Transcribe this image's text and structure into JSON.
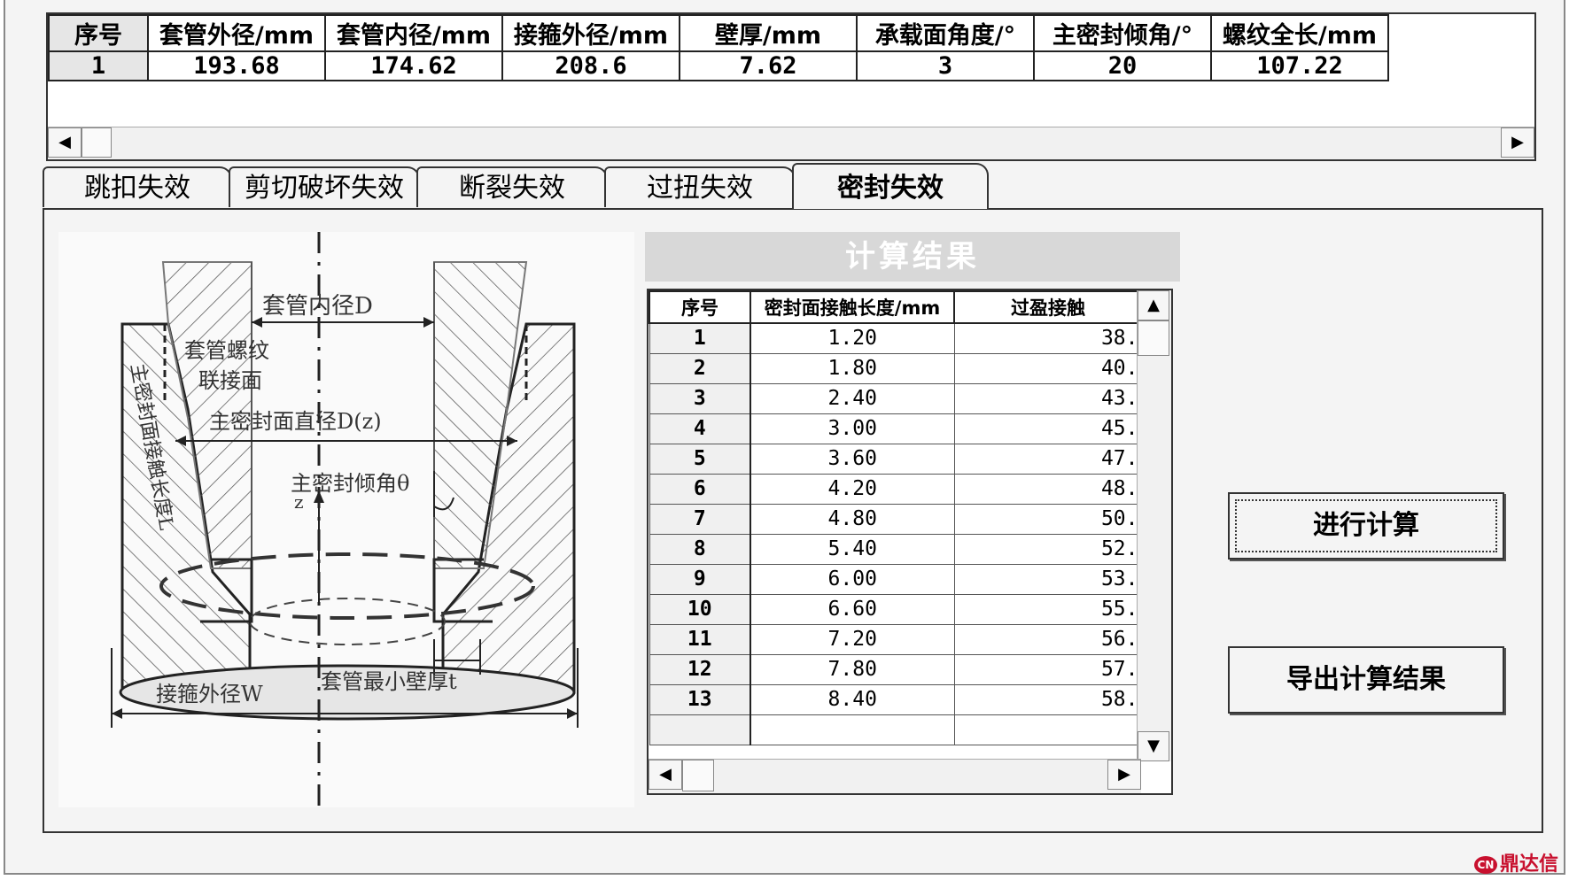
{
  "params": {
    "headers": [
      "序号",
      "套管外径/mm",
      "套管内径/mm",
      "接箍外径/mm",
      "壁厚/mm",
      "承载面角度/°",
      "主密封倾角/°",
      "螺纹全长/mm"
    ],
    "row": [
      "1",
      "193.68",
      "174.62",
      "208.6",
      "7.62",
      "3",
      "20",
      "107.22"
    ]
  },
  "tabs": [
    "跳扣失效",
    "剪切破坏失效",
    "断裂失效",
    "过扭失效",
    "密封失效"
  ],
  "active_tab": 4,
  "diagram": {
    "label_inner_diameter": "套管内径D",
    "label_thread_1": "套管螺纹",
    "label_thread_2": "联接面",
    "label_seal_diameter": "主密封面直径D(z)",
    "label_seal_angle": "主密封倾角θ",
    "label_z": "z",
    "label_coupling_od": "接箍外径W",
    "label_min_wall": "套管最小壁厚t",
    "label_side": "主密封面接触长度L"
  },
  "results": {
    "title": "计算结果",
    "headers": [
      "序号",
      "密封面接触长度/mm",
      "过盈接触"
    ],
    "rows": [
      [
        "1",
        "1.20",
        "38."
      ],
      [
        "2",
        "1.80",
        "40."
      ],
      [
        "3",
        "2.40",
        "43."
      ],
      [
        "4",
        "3.00",
        "45."
      ],
      [
        "5",
        "3.60",
        "47."
      ],
      [
        "6",
        "4.20",
        "48."
      ],
      [
        "7",
        "4.80",
        "50."
      ],
      [
        "8",
        "5.40",
        "52."
      ],
      [
        "9",
        "6.00",
        "53."
      ],
      [
        "10",
        "6.60",
        "55."
      ],
      [
        "11",
        "7.20",
        "56."
      ],
      [
        "12",
        "7.80",
        "57."
      ],
      [
        "13",
        "8.40",
        "58."
      ]
    ]
  },
  "buttons": {
    "calculate": "进行计算",
    "export": "导出计算结果"
  },
  "watermark": "鼎达信"
}
